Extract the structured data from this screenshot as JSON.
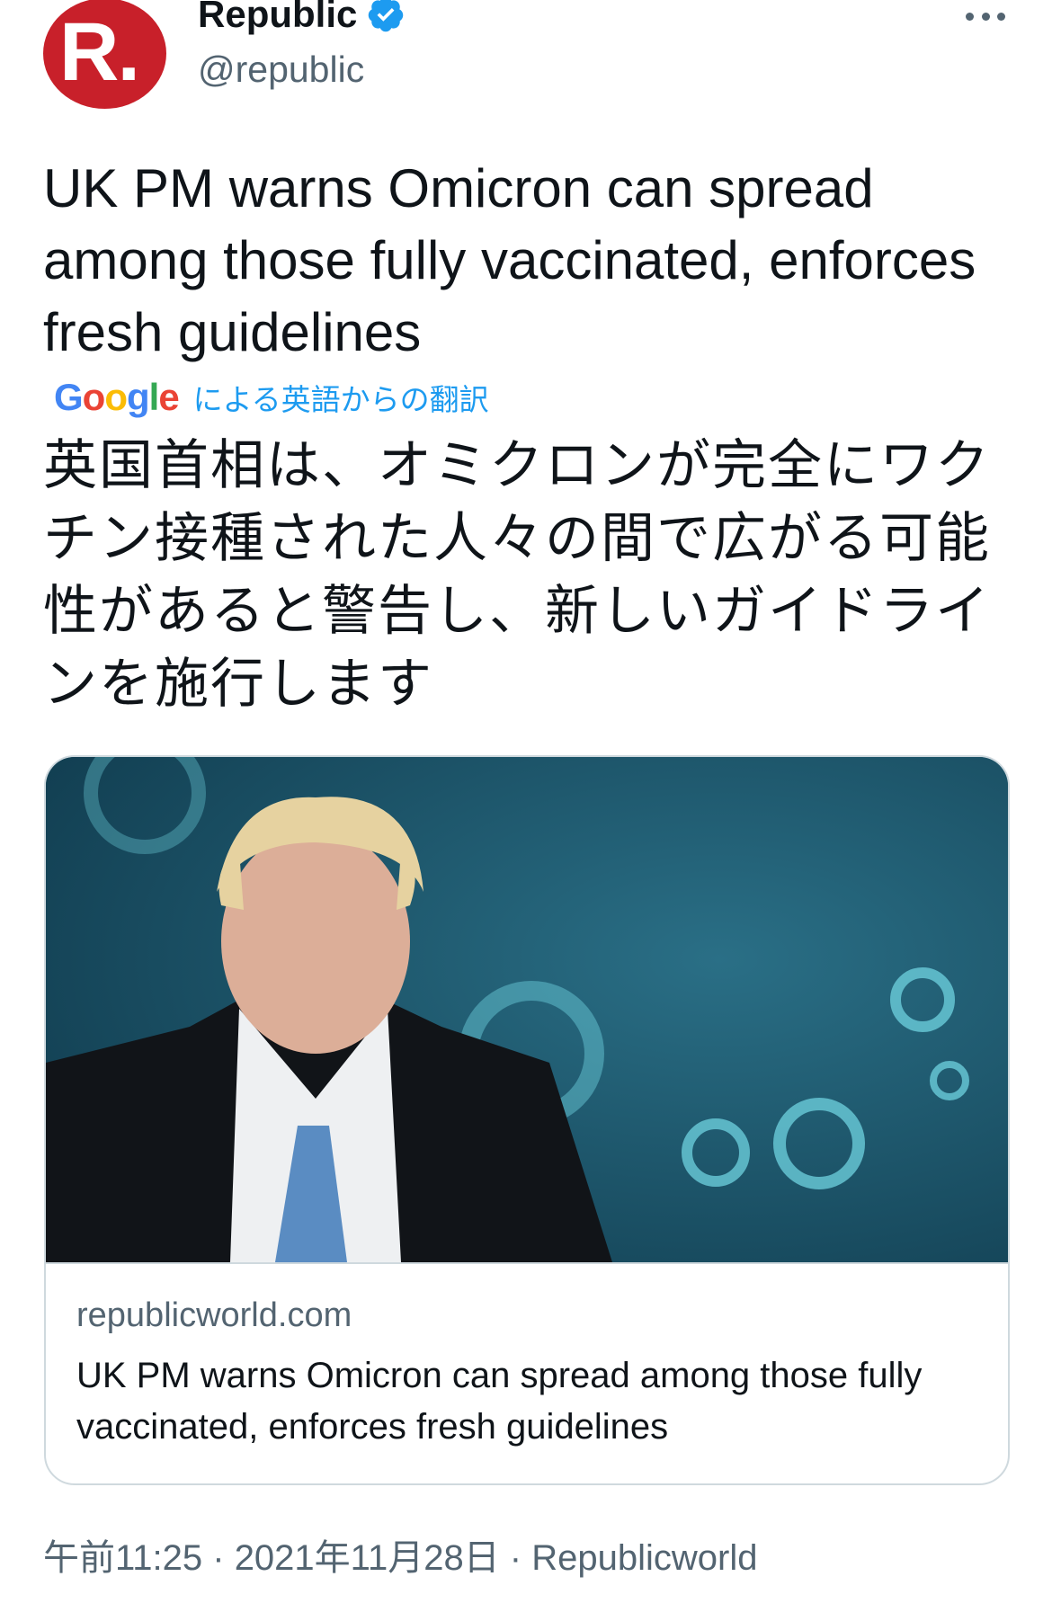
{
  "header": {
    "avatar_letter": "R.",
    "display_name": "Republic",
    "handle": "@republic"
  },
  "tweet": {
    "text": "UK PM warns Omicron can spread among those fully vaccinated, enforces fresh guidelines",
    "translation_provider": "Google",
    "translation_label": "による英語からの翻訳",
    "translated_text": "英国首相は、オミクロンが完全にワクチン接種された人々の間で広がる可能性があると警告し、新しいガイドラインを施行します"
  },
  "card": {
    "domain": "republicworld.com",
    "title": "UK PM warns Omicron can spread among those fully vaccinated, enforces fresh guidelines"
  },
  "meta": {
    "time": "午前11:25",
    "separator": " · ",
    "date": "2021年11月28日",
    "source": "Republicworld"
  },
  "colors": {
    "brand_red": "#c8202a",
    "verified_blue": "#1d9bf0",
    "secondary_text": "#536471"
  },
  "icons": [
    "avatar-logo",
    "verified-badge-icon",
    "more-options-icon",
    "google-logo"
  ]
}
